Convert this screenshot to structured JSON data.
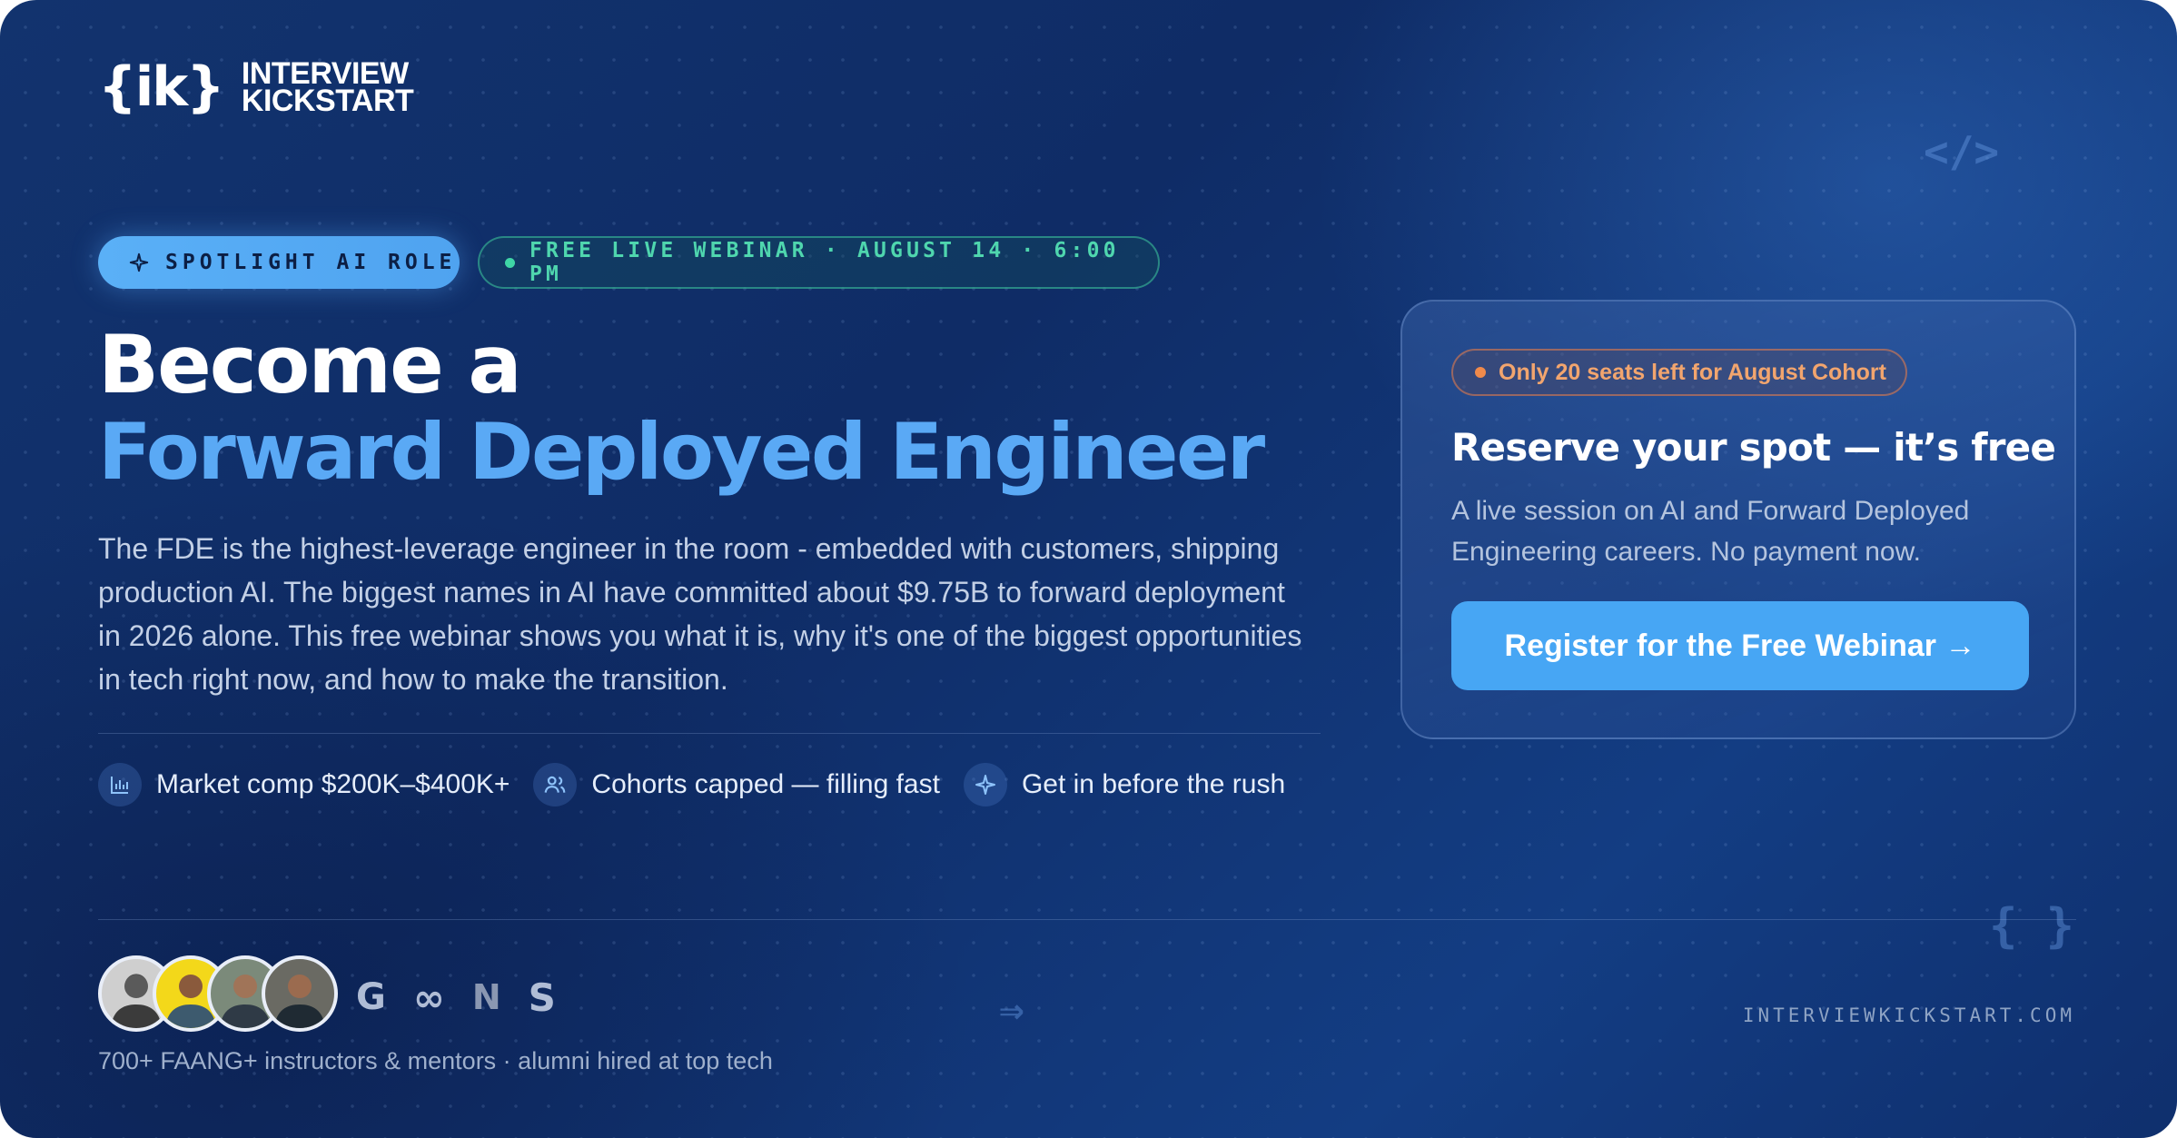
{
  "brand": {
    "mark": "{ik}",
    "line1": "INTERVIEW",
    "line2": "KICKSTART"
  },
  "decorations": {
    "code_tag": "</>",
    "braces": "{ }",
    "arrow": "⇒"
  },
  "badges": {
    "spotlight": "SPOTLIGHT AI ROLE",
    "webinar": "FREE LIVE WEBINAR · AUGUST 14 · 6:00 PM"
  },
  "headline": {
    "line1": "Become a",
    "line2": "Forward Deployed Engineer"
  },
  "description": "The FDE is the highest-leverage engineer in the room - embedded with customers, shipping production AI. The biggest names in AI have committed about $9.75B to forward deployment in 2026 alone. This free webinar shows you what it is, why it's one of the biggest opportunities in tech right now, and how to make the transition.",
  "features": [
    {
      "icon": "bar-chart-icon",
      "text": "Market comp $200K–$400K+"
    },
    {
      "icon": "users-icon",
      "text": "Cohorts capped — filling fast"
    },
    {
      "icon": "sparkle-icon",
      "text": "Get in before the rush"
    }
  ],
  "card": {
    "seats": "Only 20 seats left for August Cohort",
    "title": "Reserve your spot — it’s free",
    "subtitle": "A live session on AI and Forward Deployed Engineering careers. No payment now.",
    "cta": "Register for the Free Webinar →"
  },
  "footer": {
    "company_logos": [
      "G",
      "∞",
      "N",
      "S"
    ],
    "alumni": "700+ FAANG+ instructors & mentors · alumni hired at top tech",
    "site": "INTERVIEWKICKSTART.COM"
  },
  "colors": {
    "background": "#12336e",
    "accent_blue": "#5aa9f5",
    "cta": "#47a6f4",
    "live_green": "#4fd6ae",
    "seats_orange": "#f2a56e"
  }
}
